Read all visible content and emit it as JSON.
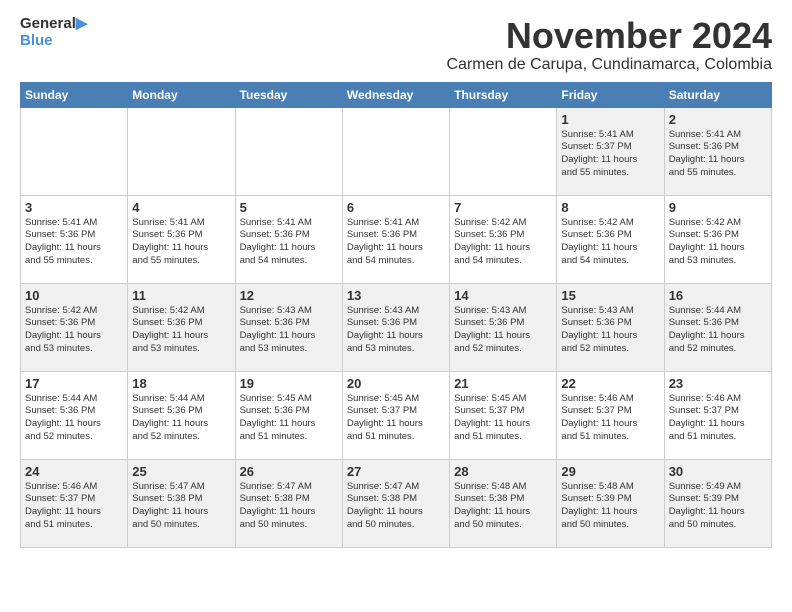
{
  "header": {
    "logo_general": "General",
    "logo_blue": "Blue",
    "month_title": "November 2024",
    "subtitle": "Carmen de Carupa, Cundinamarca, Colombia"
  },
  "calendar": {
    "days_of_week": [
      "Sunday",
      "Monday",
      "Tuesday",
      "Wednesday",
      "Thursday",
      "Friday",
      "Saturday"
    ],
    "weeks": [
      [
        {
          "day": "",
          "info": ""
        },
        {
          "day": "",
          "info": ""
        },
        {
          "day": "",
          "info": ""
        },
        {
          "day": "",
          "info": ""
        },
        {
          "day": "",
          "info": ""
        },
        {
          "day": "1",
          "info": "Sunrise: 5:41 AM\nSunset: 5:37 PM\nDaylight: 11 hours\nand 55 minutes."
        },
        {
          "day": "2",
          "info": "Sunrise: 5:41 AM\nSunset: 5:36 PM\nDaylight: 11 hours\nand 55 minutes."
        }
      ],
      [
        {
          "day": "3",
          "info": "Sunrise: 5:41 AM\nSunset: 5:36 PM\nDaylight: 11 hours\nand 55 minutes."
        },
        {
          "day": "4",
          "info": "Sunrise: 5:41 AM\nSunset: 5:36 PM\nDaylight: 11 hours\nand 55 minutes."
        },
        {
          "day": "5",
          "info": "Sunrise: 5:41 AM\nSunset: 5:36 PM\nDaylight: 11 hours\nand 54 minutes."
        },
        {
          "day": "6",
          "info": "Sunrise: 5:41 AM\nSunset: 5:36 PM\nDaylight: 11 hours\nand 54 minutes."
        },
        {
          "day": "7",
          "info": "Sunrise: 5:42 AM\nSunset: 5:36 PM\nDaylight: 11 hours\nand 54 minutes."
        },
        {
          "day": "8",
          "info": "Sunrise: 5:42 AM\nSunset: 5:36 PM\nDaylight: 11 hours\nand 54 minutes."
        },
        {
          "day": "9",
          "info": "Sunrise: 5:42 AM\nSunset: 5:36 PM\nDaylight: 11 hours\nand 53 minutes."
        }
      ],
      [
        {
          "day": "10",
          "info": "Sunrise: 5:42 AM\nSunset: 5:36 PM\nDaylight: 11 hours\nand 53 minutes."
        },
        {
          "day": "11",
          "info": "Sunrise: 5:42 AM\nSunset: 5:36 PM\nDaylight: 11 hours\nand 53 minutes."
        },
        {
          "day": "12",
          "info": "Sunrise: 5:43 AM\nSunset: 5:36 PM\nDaylight: 11 hours\nand 53 minutes."
        },
        {
          "day": "13",
          "info": "Sunrise: 5:43 AM\nSunset: 5:36 PM\nDaylight: 11 hours\nand 53 minutes."
        },
        {
          "day": "14",
          "info": "Sunrise: 5:43 AM\nSunset: 5:36 PM\nDaylight: 11 hours\nand 52 minutes."
        },
        {
          "day": "15",
          "info": "Sunrise: 5:43 AM\nSunset: 5:36 PM\nDaylight: 11 hours\nand 52 minutes."
        },
        {
          "day": "16",
          "info": "Sunrise: 5:44 AM\nSunset: 5:36 PM\nDaylight: 11 hours\nand 52 minutes."
        }
      ],
      [
        {
          "day": "17",
          "info": "Sunrise: 5:44 AM\nSunset: 5:36 PM\nDaylight: 11 hours\nand 52 minutes."
        },
        {
          "day": "18",
          "info": "Sunrise: 5:44 AM\nSunset: 5:36 PM\nDaylight: 11 hours\nand 52 minutes."
        },
        {
          "day": "19",
          "info": "Sunrise: 5:45 AM\nSunset: 5:36 PM\nDaylight: 11 hours\nand 51 minutes."
        },
        {
          "day": "20",
          "info": "Sunrise: 5:45 AM\nSunset: 5:37 PM\nDaylight: 11 hours\nand 51 minutes."
        },
        {
          "day": "21",
          "info": "Sunrise: 5:45 AM\nSunset: 5:37 PM\nDaylight: 11 hours\nand 51 minutes."
        },
        {
          "day": "22",
          "info": "Sunrise: 5:46 AM\nSunset: 5:37 PM\nDaylight: 11 hours\nand 51 minutes."
        },
        {
          "day": "23",
          "info": "Sunrise: 5:46 AM\nSunset: 5:37 PM\nDaylight: 11 hours\nand 51 minutes."
        }
      ],
      [
        {
          "day": "24",
          "info": "Sunrise: 5:46 AM\nSunset: 5:37 PM\nDaylight: 11 hours\nand 51 minutes."
        },
        {
          "day": "25",
          "info": "Sunrise: 5:47 AM\nSunset: 5:38 PM\nDaylight: 11 hours\nand 50 minutes."
        },
        {
          "day": "26",
          "info": "Sunrise: 5:47 AM\nSunset: 5:38 PM\nDaylight: 11 hours\nand 50 minutes."
        },
        {
          "day": "27",
          "info": "Sunrise: 5:47 AM\nSunset: 5:38 PM\nDaylight: 11 hours\nand 50 minutes."
        },
        {
          "day": "28",
          "info": "Sunrise: 5:48 AM\nSunset: 5:38 PM\nDaylight: 11 hours\nand 50 minutes."
        },
        {
          "day": "29",
          "info": "Sunrise: 5:48 AM\nSunset: 5:39 PM\nDaylight: 11 hours\nand 50 minutes."
        },
        {
          "day": "30",
          "info": "Sunrise: 5:49 AM\nSunset: 5:39 PM\nDaylight: 11 hours\nand 50 minutes."
        }
      ]
    ]
  }
}
